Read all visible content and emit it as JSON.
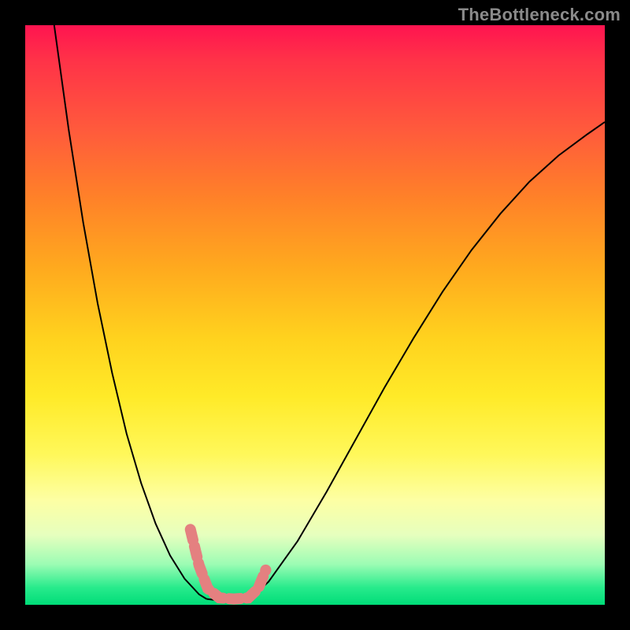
{
  "watermark": "TheBottleneck.com",
  "chart_data": {
    "type": "line",
    "title": "",
    "xlabel": "",
    "ylabel": "",
    "xlim": [
      0,
      1
    ],
    "ylim": [
      0,
      1
    ],
    "series": [
      {
        "name": "left-curve",
        "x": [
          0.05,
          0.075,
          0.1,
          0.125,
          0.15,
          0.175,
          0.2,
          0.225,
          0.25,
          0.275,
          0.3,
          0.313
        ],
        "y": [
          1.0,
          0.82,
          0.66,
          0.52,
          0.4,
          0.295,
          0.21,
          0.14,
          0.085,
          0.045,
          0.018,
          0.01
        ]
      },
      {
        "name": "valley-floor",
        "x": [
          0.313,
          0.33,
          0.36,
          0.388
        ],
        "y": [
          0.01,
          0.008,
          0.008,
          0.01
        ]
      },
      {
        "name": "right-curve",
        "x": [
          0.388,
          0.42,
          0.47,
          0.52,
          0.57,
          0.62,
          0.67,
          0.72,
          0.77,
          0.82,
          0.87,
          0.92,
          0.97,
          1.0
        ],
        "y": [
          0.01,
          0.04,
          0.11,
          0.195,
          0.285,
          0.375,
          0.46,
          0.54,
          0.612,
          0.675,
          0.73,
          0.775,
          0.812,
          0.833
        ]
      }
    ],
    "highlight": {
      "description": "dashed pink segment around valley bottom",
      "path_xy": [
        [
          0.285,
          0.13
        ],
        [
          0.3,
          0.068
        ],
        [
          0.315,
          0.028
        ],
        [
          0.335,
          0.012
        ],
        [
          0.36,
          0.01
        ],
        [
          0.385,
          0.012
        ],
        [
          0.402,
          0.028
        ],
        [
          0.415,
          0.06
        ]
      ],
      "color": "#e48080"
    },
    "legend": null,
    "annotations": []
  }
}
